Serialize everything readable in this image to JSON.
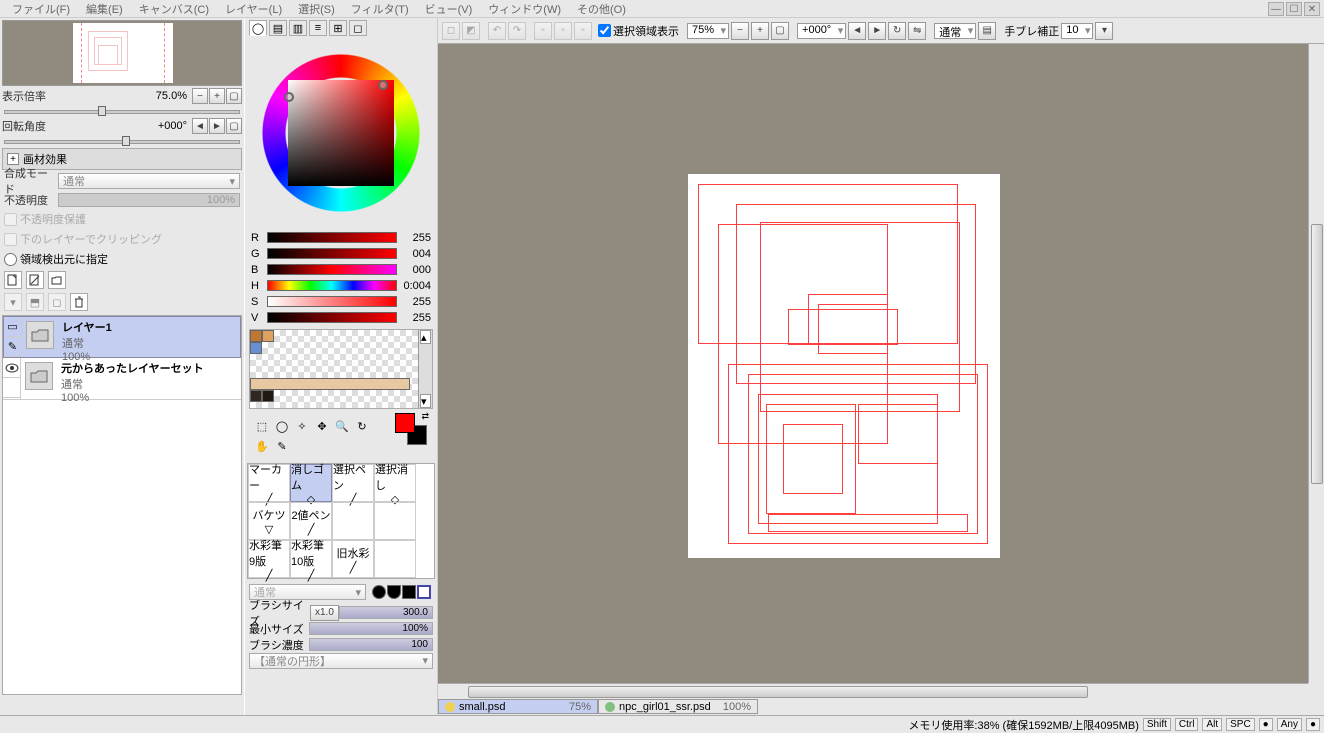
{
  "menu": {
    "file": "ファイル(F)",
    "edit": "編集(E)",
    "canvas": "キャンバス(C)",
    "layer": "レイヤー(L)",
    "select": "選択(S)",
    "filter": "フィルタ(T)",
    "view": "ビュー(V)",
    "window": "ウィンドウ(W)",
    "other": "その他(O)"
  },
  "nav": {
    "zoom_label": "表示倍率",
    "zoom_value": "75.0%",
    "rot_label": "回転角度",
    "rot_value": "+000°"
  },
  "material": {
    "header": "画材効果",
    "blend_label": "合成モード",
    "blend_value": "通常",
    "opacity_label": "不透明度",
    "opacity_value": "100%",
    "preserve": "不透明度保護",
    "clip": "下のレイヤーでクリッピング",
    "source": "領域検出元に指定"
  },
  "layers": [
    {
      "name": "レイヤー1",
      "mode": "通常",
      "opacity": "100%",
      "selected": true
    },
    {
      "name": "元からあったレイヤーセット",
      "mode": "通常",
      "opacity": "100%",
      "selected": false
    }
  ],
  "rgb": {
    "r": {
      "l": "R",
      "v": "255"
    },
    "g": {
      "l": "G",
      "v": "004"
    },
    "b": {
      "l": "B",
      "v": "000"
    },
    "h": {
      "l": "H",
      "v": "0:004"
    },
    "s": {
      "l": "S",
      "v": "255"
    },
    "vv": {
      "l": "V",
      "v": "255"
    }
  },
  "brushes": {
    "row1": [
      "マーカー",
      "消しゴム",
      "選択ペン",
      "選択消し"
    ],
    "row2": [
      "バケツ",
      "2値ペン",
      "",
      ""
    ],
    "row3": [
      "水彩筆 9版",
      "水彩筆 10版",
      "旧水彩",
      ""
    ]
  },
  "brush_mode": "通常",
  "params": {
    "size_label": "ブラシサイズ",
    "size_mult": "x1.0",
    "size_val": "300.0",
    "min_label": "最小サイズ",
    "min_val": "100%",
    "density_label": "ブラシ濃度",
    "density_val": "100",
    "shape_label": "【通常の円形】"
  },
  "toolbar": {
    "selvis": "選択領域表示",
    "zoom": "75%",
    "angle": "+000°",
    "mode": "通常",
    "stab_label": "手ブレ補正",
    "stab_val": "10"
  },
  "files": [
    {
      "name": "small.psd",
      "zoom": "75%",
      "active": true,
      "color": "#f0d050"
    },
    {
      "name": "npc_girl01_ssr.psd",
      "zoom": "100%",
      "active": false,
      "color": "#80c080"
    }
  ],
  "status": {
    "mem": "メモリ使用率:38% (確保1592MB/上限4095MB)",
    "keys": [
      "Shift",
      "Ctrl",
      "Alt",
      "SPC",
      "●",
      "Any",
      "●"
    ]
  }
}
